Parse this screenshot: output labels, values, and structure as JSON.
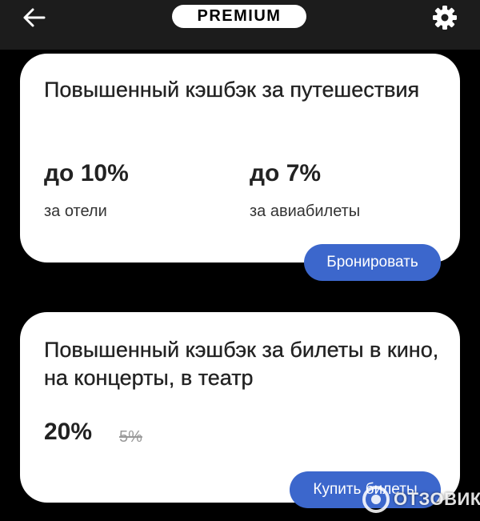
{
  "header": {
    "badge": "PREMIUM",
    "back_icon": "arrow-left-icon",
    "settings_icon": "gear-icon"
  },
  "travel_card": {
    "title": "Повышенный кэшбэк за путешествия",
    "stats": [
      {
        "value": "до 10%",
        "label": "за отели"
      },
      {
        "value": "до 7%",
        "label": "за авиабилеты"
      }
    ],
    "button": "Бронировать"
  },
  "tickets_card": {
    "title": "Повышенный кэшбэк за билеты в кино, на концерты, в театр",
    "value": "20%",
    "old_value": "5%",
    "button": "Купить билеты"
  },
  "watermark": {
    "text": "ОТЗОВИК"
  },
  "colors": {
    "background": "#000000",
    "topbar": "#1c1c1c",
    "button": "#3c67cc",
    "card": "#ffffff"
  }
}
